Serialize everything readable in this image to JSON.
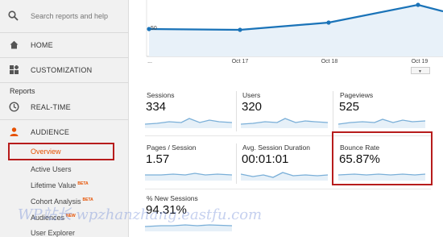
{
  "sidebar": {
    "search_placeholder": "Search reports and help",
    "home_label": "HOME",
    "customization_label": "CUSTOMIZATION",
    "reports_section": "Reports",
    "realtime_label": "REAL-TIME",
    "audience_label": "AUDIENCE",
    "audience_items": [
      {
        "label": "Overview",
        "badge": ""
      },
      {
        "label": "Active Users",
        "badge": ""
      },
      {
        "label": "Lifetime Value",
        "badge": "BETA"
      },
      {
        "label": "Cohort Analysis",
        "badge": "BETA"
      },
      {
        "label": "Audiences",
        "badge": "NEW"
      },
      {
        "label": "User Explorer",
        "badge": ""
      }
    ]
  },
  "main_chart": {
    "y_label": "50",
    "x_ticks": [
      "...",
      "Oct 17",
      "Oct 18",
      "Oct 19"
    ],
    "line_color": "#1a73b8"
  },
  "metrics": [
    {
      "label": "Sessions",
      "value": "334"
    },
    {
      "label": "Users",
      "value": "320"
    },
    {
      "label": "Pageviews",
      "value": "525"
    },
    {
      "label": "Pages / Session",
      "value": "1.57"
    },
    {
      "label": "Avg. Session Duration",
      "value": "00:01:01"
    },
    {
      "label": "Bounce Rate",
      "value": "65.87%"
    },
    {
      "label": "% New Sessions",
      "value": "94.31%"
    }
  ],
  "watermark": "WP站长 wpzhanzhang.eastfu.com",
  "colors": {
    "highlight": "#b71c1c",
    "active_item": "#e65100",
    "sparkline": "#7aafd8"
  }
}
